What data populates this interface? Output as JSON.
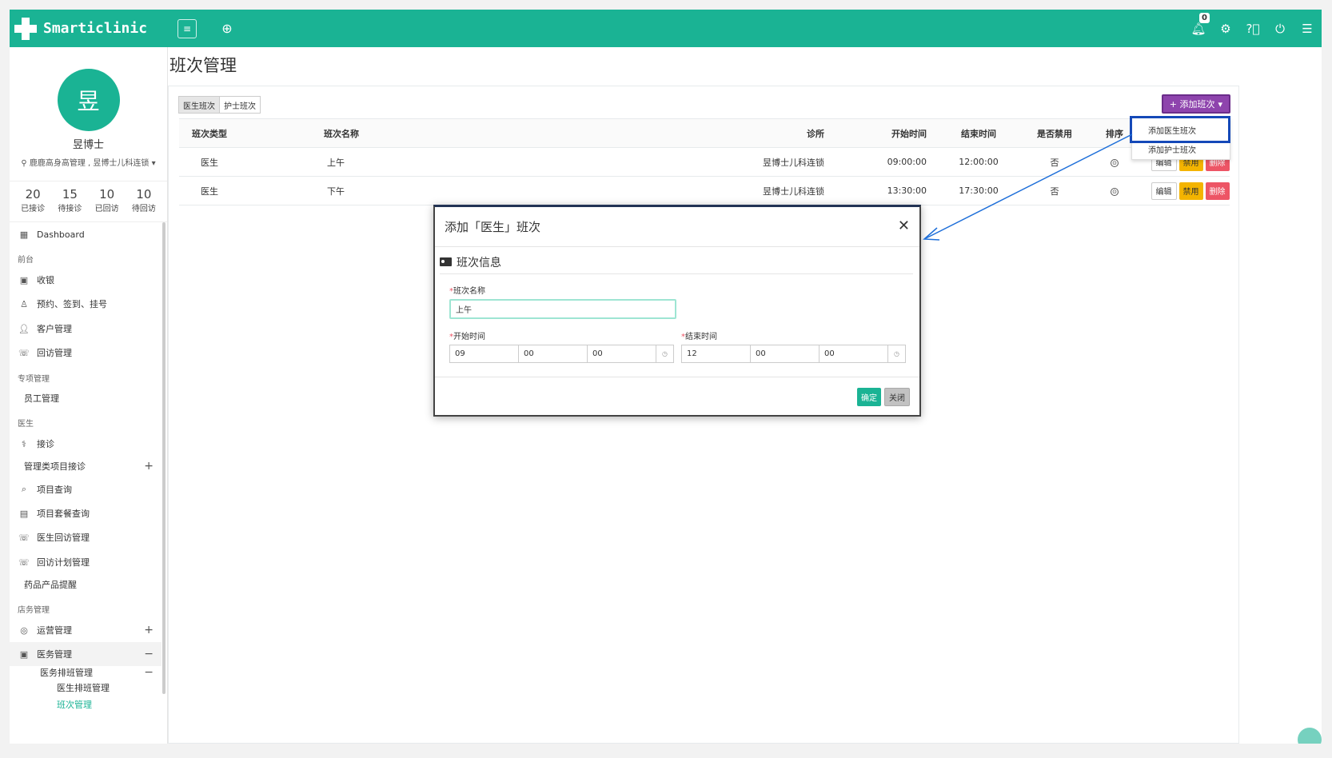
{
  "app": {
    "name": "Smarticlinic",
    "notification_count": "0"
  },
  "topbar": {
    "icons": [
      "menu-icon",
      "add-circle-icon",
      "bell-icon",
      "gear-icon",
      "help-icon",
      "power-icon",
      "list-icon"
    ]
  },
  "profile": {
    "avatar_char": "昱",
    "name": "昱博士",
    "org": "鹿鹿高身高管理 , 昱博士儿科连锁",
    "stats": [
      {
        "value": "20",
        "label": "已接诊"
      },
      {
        "value": "15",
        "label": "待接诊"
      },
      {
        "value": "10",
        "label": "已回访"
      },
      {
        "value": "10",
        "label": "待回访"
      }
    ]
  },
  "nav": {
    "dashboard": "Dashboard",
    "sec_front": "前台",
    "cashier": "收银",
    "booking": "预约、签到、挂号",
    "customer": "客户管理",
    "followup": "回访管理",
    "sec_special": "专项管理",
    "staff": "员工管理",
    "sec_doctor": "医生",
    "consult": "接诊",
    "mgmt_consult": "管理类项目接诊",
    "item_query": "项目查询",
    "package_query": "项目套餐查询",
    "doc_followup": "医生回访管理",
    "plan_followup": "回访计划管理",
    "drug_remind": "药品产品提醒",
    "sec_store": "店务管理",
    "operations": "运营管理",
    "medical": "医务管理",
    "schedule_mgmt": "医务排班管理",
    "doc_schedule": "医生排班管理",
    "shift_mgmt": "班次管理"
  },
  "page": {
    "title": "班次管理",
    "tabs": [
      "医生班次",
      "护士班次"
    ],
    "add_button": "+ 添加班次",
    "dropdown": [
      "添加医生班次",
      "添加护士班次"
    ]
  },
  "table": {
    "headers": [
      "班次类型",
      "班次名称",
      "诊所",
      "开始时间",
      "结束时间",
      "是否禁用",
      "排序"
    ],
    "rows": [
      {
        "type": "医生",
        "name": "上午",
        "clinic": "昱博士儿科连锁",
        "start": "09:00:00",
        "end": "12:00:00",
        "disabled": "否"
      },
      {
        "type": "医生",
        "name": "下午",
        "clinic": "昱博士儿科连锁",
        "start": "13:30:00",
        "end": "17:30:00",
        "disabled": "否"
      }
    ],
    "actions": {
      "edit": "编辑",
      "disable": "禁用",
      "delete": "删除"
    }
  },
  "modal": {
    "title": "添加「医生」班次",
    "section": "班次信息",
    "name_label": "班次名称",
    "name_value": "上午",
    "start_label": "开始时间",
    "end_label": "结束时间",
    "start": [
      "09",
      "00",
      "00"
    ],
    "end": [
      "12",
      "00",
      "00"
    ],
    "ok": "确定",
    "cancel": "关闭",
    "required_mark": "*"
  },
  "colors": {
    "brand": "#1ab394",
    "add_button": "#8e44ad",
    "delete": "#ed5565",
    "disable": "#f4b400",
    "highlight": "#1549b8"
  }
}
